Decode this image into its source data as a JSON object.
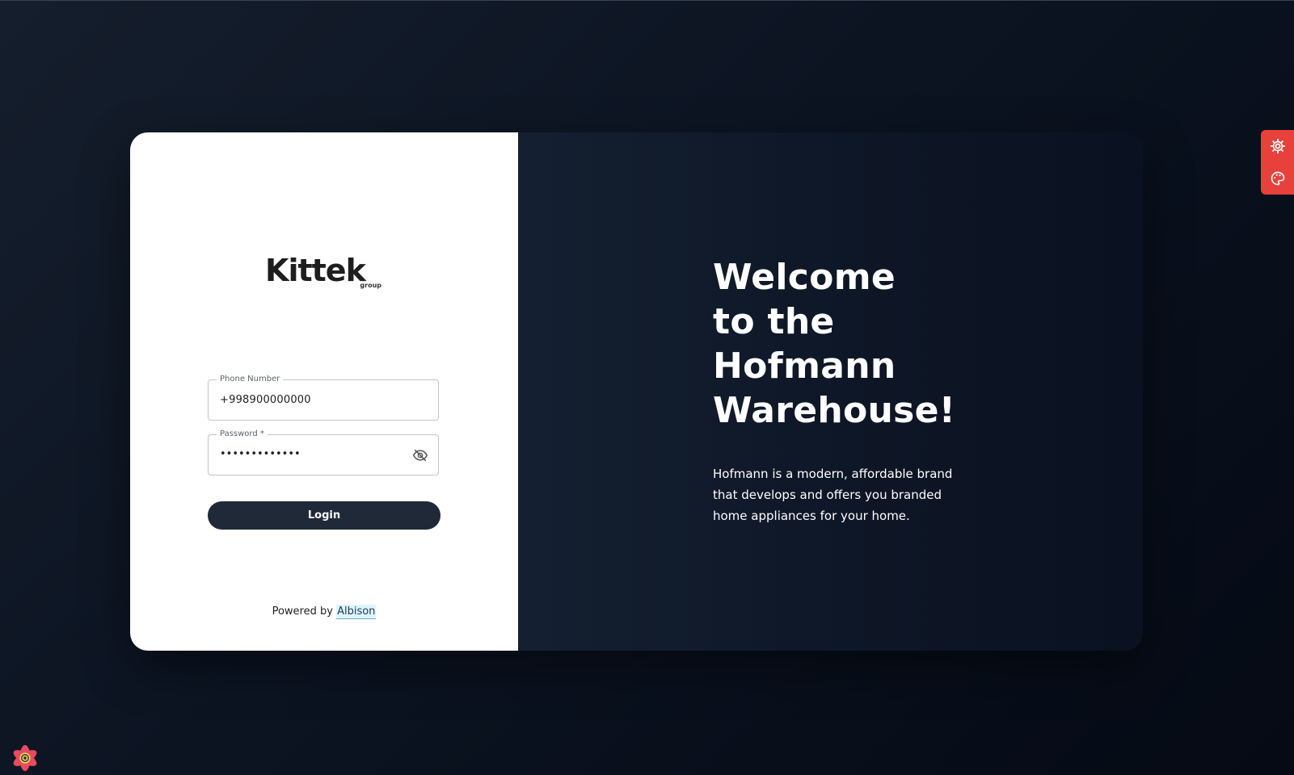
{
  "brand": {
    "logo_text": "Kittek",
    "logo_subtext": "group"
  },
  "login_form": {
    "phone": {
      "label": "Phone Number",
      "value": "+998900000000"
    },
    "password": {
      "label": "Password *",
      "masked_value": "•••••••••••••",
      "toggle_icon": "eye-off-icon"
    },
    "login_label": "Login"
  },
  "footer": {
    "powered_prefix": "Powered by",
    "powered_link": "Albison"
  },
  "hero": {
    "title_lines": [
      "Welcome",
      "to the",
      "Hofmann",
      "Warehouse!"
    ],
    "description": "Hofmann is a modern, affordable brand that develops and offers you branded home appliances for your home."
  },
  "side_tools": {
    "items": [
      "settings-gear-icon",
      "palette-icon"
    ],
    "color": "#e8403a"
  },
  "colors": {
    "button_bg": "#1f2938",
    "background_dark": "#0c1422",
    "accent_red": "#e8403a"
  }
}
